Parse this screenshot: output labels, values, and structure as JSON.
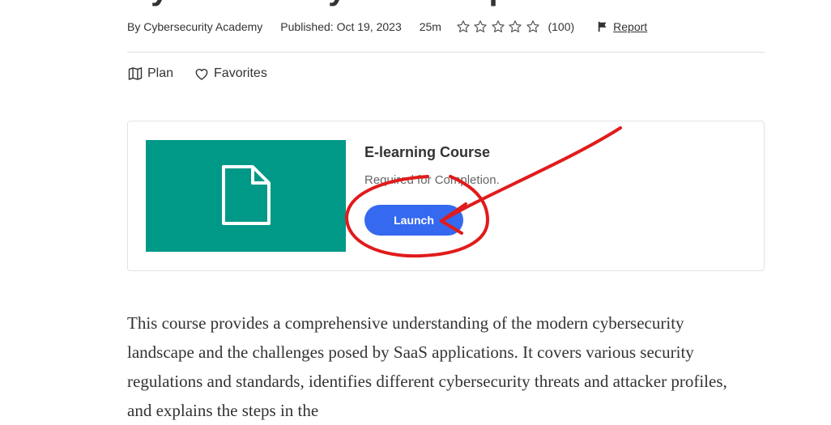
{
  "course": {
    "title": "Cybersecurity Landscape",
    "author": "By Cybersecurity Academy",
    "published": "Published: Oct 19, 2023",
    "duration": "25m",
    "rating": 0,
    "rating_count": "(100)",
    "report_label": "Report"
  },
  "actions": {
    "plan_label": "Plan",
    "favorites_label": "Favorites"
  },
  "card": {
    "type_title": "E-learning Course",
    "requirement": "Required for Completion.",
    "launch_label": "Launch",
    "thumb_color": "#009987"
  },
  "description": "This course provides a comprehensive understanding of the modern cybersecurity landscape and the challenges posed by SaaS applications. It covers various security regulations and standards, identifies different cybersecurity threats and attacker profiles, and explains the steps in the",
  "colors": {
    "accent": "#3569f0",
    "annotation": "#e11b1b"
  }
}
